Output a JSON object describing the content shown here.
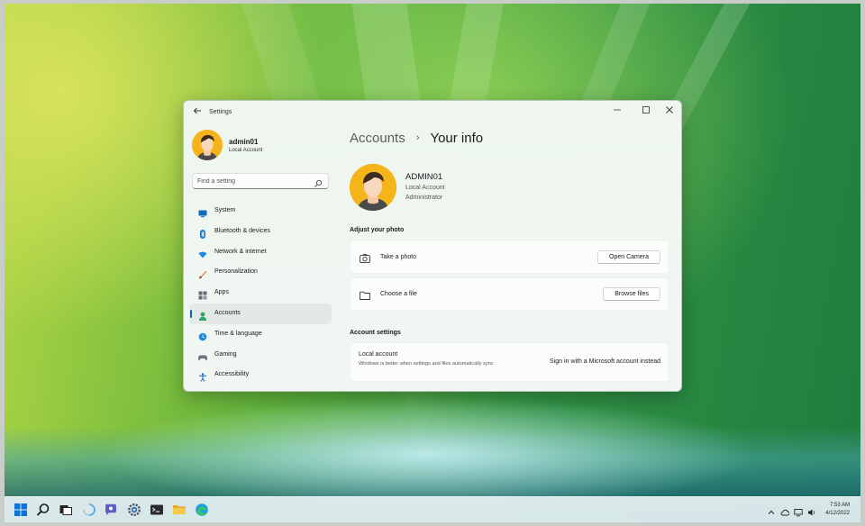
{
  "window": {
    "title": "Settings",
    "controls": {
      "minimize": "—",
      "maximize": "☐",
      "close": "✕"
    }
  },
  "sidebar": {
    "profile": {
      "name": "admin01",
      "type": "Local Account"
    },
    "search": {
      "placeholder": "Find a setting"
    },
    "items": [
      {
        "label": "System",
        "icon": "monitor-icon",
        "color": "#0f6cbd"
      },
      {
        "label": "Bluetooth & devices",
        "icon": "bluetooth-icon",
        "color": "#1a73c8"
      },
      {
        "label": "Network & internet",
        "icon": "wifi-icon",
        "color": "#1e88e5"
      },
      {
        "label": "Personalization",
        "icon": "brush-icon",
        "color": "#d2793a"
      },
      {
        "label": "Apps",
        "icon": "apps-icon",
        "color": "#5f6b7a"
      },
      {
        "label": "Accounts",
        "icon": "person-icon",
        "color": "#2fa56a",
        "active": true
      },
      {
        "label": "Time & language",
        "icon": "globe-clock-icon",
        "color": "#1e88e5"
      },
      {
        "label": "Gaming",
        "icon": "gamepad-icon",
        "color": "#6b7280"
      },
      {
        "label": "Accessibility",
        "icon": "accessibility-icon",
        "color": "#1668c0"
      }
    ]
  },
  "main": {
    "breadcrumb": {
      "parent": "Accounts",
      "separator": "›",
      "current": "Your info"
    },
    "user": {
      "name": "ADMIN01",
      "account_type": "Local Account",
      "role": "Administrator"
    },
    "adjust_photo": {
      "heading": "Adjust your photo",
      "take_photo": {
        "label": "Take a photo",
        "button": "Open Camera"
      },
      "choose_file": {
        "label": "Choose a file",
        "button": "Browse files"
      }
    },
    "account_settings": {
      "heading": "Account settings",
      "local_account": {
        "title": "Local account",
        "description": "Windows is better when settings and files automatically sync",
        "action": "Sign in with a Microsoft account instead"
      }
    }
  },
  "taskbar": {
    "apps": [
      "windows-start-icon",
      "search-icon",
      "task-view-icon",
      "widgets-icon",
      "chat-icon",
      "settings-icon",
      "terminal-icon",
      "file-explorer-icon",
      "edge-icon"
    ],
    "tray": [
      "chevron-up-icon",
      "cloud-icon",
      "network-icon",
      "volume-icon"
    ],
    "time": "7:53 AM",
    "date": "4/12/2022"
  },
  "colors": {
    "accent": "#0067c0",
    "avatar_bg": "#f4b41a"
  }
}
